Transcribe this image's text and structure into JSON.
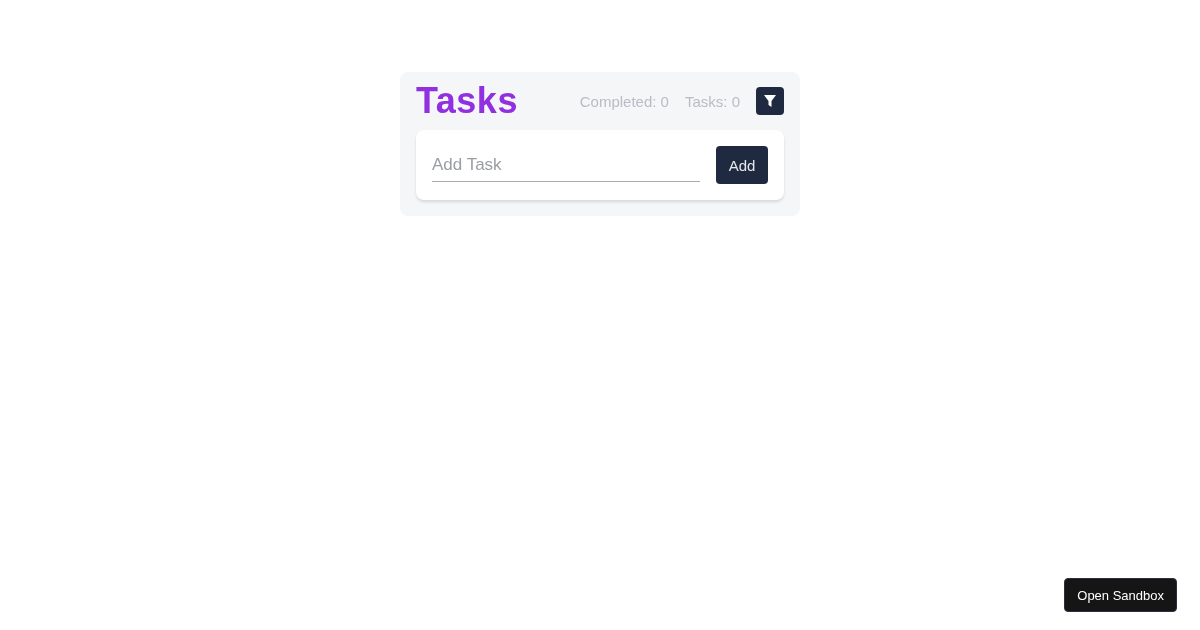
{
  "title": "Tasks",
  "stats": [
    {
      "label": "Completed: 0"
    },
    {
      "label": "Tasks: 0"
    }
  ],
  "add_form": {
    "placeholder": "Add Task",
    "button": "Add"
  },
  "sandbox_button": "Open Sandbox"
}
